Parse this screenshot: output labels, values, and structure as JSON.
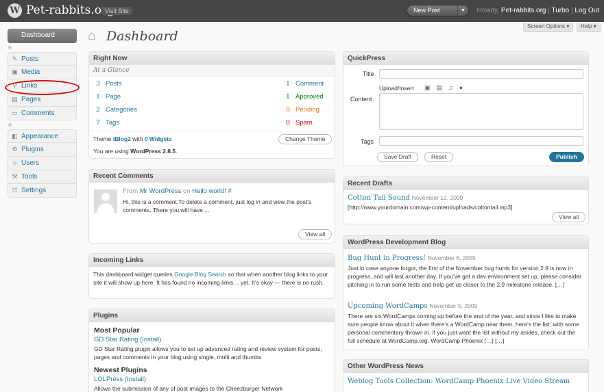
{
  "header": {
    "logo_letter": "W",
    "site_title": "Pet-rabbits.org",
    "visit_site": "Visit Site",
    "new_post": "New Post",
    "howdy": "Howdy,",
    "username": "Pet-rabbits.org",
    "separator": "|",
    "turbo": "Turbo",
    "log_out": "Log Out"
  },
  "screen_meta": {
    "screen_options": "Screen Options",
    "help": "Help"
  },
  "menu": {
    "dashboard": "Dashboard",
    "posts": "Posts",
    "media": "Media",
    "links": "Links",
    "pages": "Pages",
    "comments": "Comments",
    "appearance": "Appearance",
    "plugins": "Plugins",
    "users": "Users",
    "tools": "Tools",
    "settings": "Settings"
  },
  "page_title": "Dashboard",
  "right_now": {
    "title": "Right Now",
    "subtitle": "At a Glance",
    "content": [
      {
        "count": "3",
        "label": "Posts"
      },
      {
        "count": "1",
        "label": "Page"
      },
      {
        "count": "2",
        "label": "Categories"
      },
      {
        "count": "7",
        "label": "Tags"
      }
    ],
    "discussion": [
      {
        "count": "1",
        "label": "Comment"
      },
      {
        "count": "1",
        "label": "Approved"
      },
      {
        "count": "0",
        "label": "Pending"
      },
      {
        "count": "0",
        "label": "Spam"
      }
    ],
    "theme_prefix": "Theme",
    "theme_name": "iBlog2",
    "theme_with": "with",
    "widgets": "0 Widgets",
    "version_prefix": "You are using",
    "version": "WordPress 2.8.5",
    "version_suffix": ".",
    "change_theme": "Change Theme"
  },
  "recent_comments": {
    "title": "Recent Comments",
    "from": "From",
    "author": "Mr WordPress",
    "on": "on",
    "post": "Hello world!",
    "hash": "#",
    "excerpt": "Hi, this is a comment.To delete a comment, just log in and view the post's comments. There you will have ...",
    "view_all": "View all"
  },
  "incoming_links": {
    "title": "Incoming Links",
    "text_before": "This dashboard widget queries",
    "link": "Google Blog Search",
    "text_after": "so that when another blog links to your site it will show up here. It has found no incoming links… yet. It’s okay — there is no rush."
  },
  "plugins": {
    "title": "Plugins",
    "most_popular": "Most Popular",
    "popular_name": "GD Star Rating",
    "install": "Install",
    "popular_desc": "GD Star Rating plugin allows you to set up advanced rating and review system for posts, pages and comments in your blog using single, multi and thumbs",
    "newest": "Newest Plugins",
    "newest_name": "LOLPress",
    "newest_desc": "Allows the submission of any of post images to the Cheezburger Network"
  },
  "quickpress": {
    "title": "QuickPress",
    "title_label": "Title",
    "upload_insert": "Upload/Insert",
    "content_label": "Content",
    "tags_label": "Tags",
    "save_draft": "Save Draft",
    "reset": "Reset",
    "publish": "Publish"
  },
  "recent_drafts": {
    "title": "Recent Drafts",
    "draft_title": "Cotton Tail Sound",
    "draft_date": "November 12, 2009",
    "draft_excerpt": "[http://www.yourdomain.com/wp-content/uploads/cottontail.mp3]",
    "view_all": "View all"
  },
  "dev_blog": {
    "title": "WordPress Development Blog",
    "items": [
      {
        "title": "Bug Hunt in Progress!",
        "date": "November 6, 2009",
        "text": "Just in case anyone forgot, the first of the November bug hunts for version 2.9 is now in progress, and will last another day. If you’ve got a dev environment set up, please consider pitching in to run some tests and help get us closer to the 2.9 milestone release. […]"
      },
      {
        "title": "Upcoming WordCamps",
        "date": "November 5, 2009",
        "text": "There are six WordCamps coming up before the end of the year, and since I like to make sure people know about it when there’s a WordCamp near them, here’s the list, with some personal commentary thrown in. If you just want the list without my asides, check out the full schedule at WordCamp.org. WordCamp Phoenix […] […]"
      }
    ]
  },
  "other_news": {
    "title": "Other WordPress News",
    "item": "Weblog Tools Collection: WordCamp Phoenix Live Video Stream"
  },
  "colors": {
    "header_bg": "#464646",
    "link": "#21759b",
    "highlight_circle": "#d40000"
  }
}
